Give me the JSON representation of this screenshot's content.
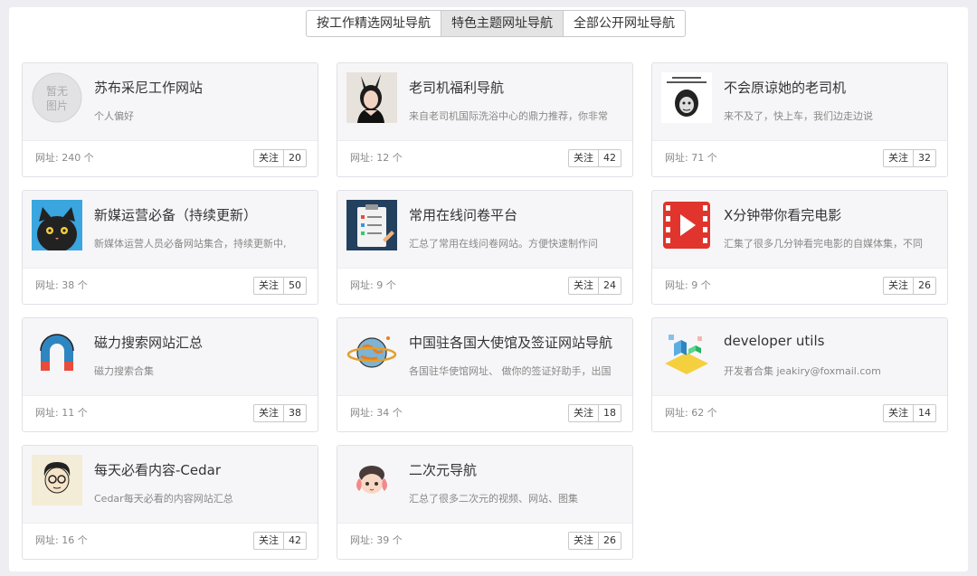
{
  "tabs": [
    {
      "label": "按工作精选网址导航",
      "active": false
    },
    {
      "label": "特色主题网址导航",
      "active": true
    },
    {
      "label": "全部公开网址导航",
      "active": false
    }
  ],
  "follow_label": "关注",
  "placeholder_text": [
    "暂无",
    "图片"
  ],
  "cards": [
    {
      "title": "苏布采尼工作网站",
      "desc": "个人偏好",
      "count": "网址: 240 个",
      "follows": "20",
      "icon": "no-image-placeholder-icon"
    },
    {
      "title": "老司机福利导航",
      "desc": "来自老司机国际洗浴中心的鼎力推荐，你非常",
      "count": "网址: 12 个",
      "follows": "42",
      "icon": "bunny-girl-photo"
    },
    {
      "title": "不会原谅她的老司机",
      "desc": "来不及了，快上车，我们边走边说",
      "count": "网址: 71 个",
      "follows": "32",
      "icon": "meme-face-image"
    },
    {
      "title": "新媒运营必备（持续更新）",
      "desc": "新媒体运营人员必备网站集合，持续更新中,",
      "count": "网址: 38 个",
      "follows": "50",
      "icon": "black-cat-icon"
    },
    {
      "title": "常用在线问卷平台",
      "desc": "汇总了常用在线问卷网站。方便快速制作问",
      "count": "网址: 9 个",
      "follows": "24",
      "icon": "clipboard-survey-icon"
    },
    {
      "title": "X分钟带你看完电影",
      "desc": "汇集了很多几分钟看完电影的自媒体集，不同",
      "count": "网址: 9 个",
      "follows": "26",
      "icon": "film-play-icon"
    },
    {
      "title": "磁力搜索网站汇总",
      "desc": "磁力搜索合集",
      "count": "网址: 11 个",
      "follows": "38",
      "icon": "magnet-icon"
    },
    {
      "title": "中国驻各国大使馆及签证网站导航",
      "desc": "各国驻华使馆网址、 做你的签证好助手，出国",
      "count": "网址: 34 个",
      "follows": "18",
      "icon": "planet-icon"
    },
    {
      "title": "developer utils",
      "desc": "开发者合集 jeakiry@foxmail.com",
      "count": "网址: 62 个",
      "follows": "14",
      "icon": "isometric-city-icon"
    },
    {
      "title": "每天必看内容-Cedar",
      "desc": "Cedar每天必看的内容网站汇总",
      "count": "网址: 16 个",
      "follows": "42",
      "icon": "cartoon-face-icon"
    },
    {
      "title": "二次元导航",
      "desc": "汇总了很多二次元的视频、网站、图集",
      "count": "网址: 39 个",
      "follows": "26",
      "icon": "anime-girl-icon"
    }
  ]
}
